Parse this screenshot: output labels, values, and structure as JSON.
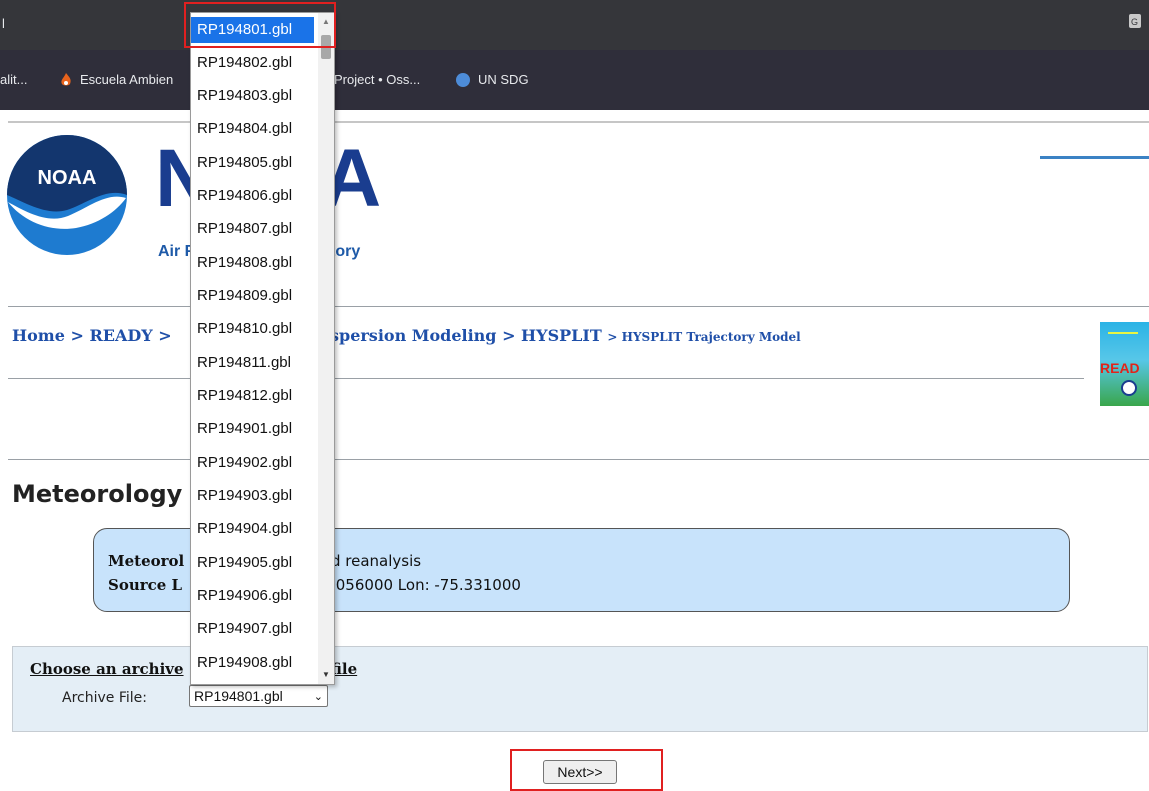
{
  "browser": {
    "tab_title": "l",
    "bookmarks": [
      {
        "label": "alit..."
      },
      {
        "label": "Escuela Ambien"
      },
      {
        "label": "Project • Oss..."
      },
      {
        "label": "UN SDG"
      }
    ]
  },
  "header": {
    "logo_text": "NOAA",
    "title_left": "N",
    "title_right": "A",
    "subtitle_left": "Air F",
    "subtitle_right": "tory"
  },
  "breadcrumb": {
    "home": "Home",
    "ready": "> READY",
    "sep": ">",
    "dispersion": "spersion Modeling",
    "hysplit": "> HYSPLIT",
    "current": "> HYSPLIT Trajectory Model"
  },
  "ready_logo_text": "READ",
  "page_heading": "Meteorology",
  "info": {
    "line1_label": "Meteorol",
    "line1_value": "d reanalysis",
    "line2_label": "Source L",
    "line2_value": ".056000 Lon: -75.331000"
  },
  "archive": {
    "choose_label": "Choose an archive",
    "choose_label_tail": "file",
    "archive_file_label": "Archive File:",
    "selected_value": "RP194801.gbl",
    "options": [
      "RP194801.gbl",
      "RP194802.gbl",
      "RP194803.gbl",
      "RP194804.gbl",
      "RP194805.gbl",
      "RP194806.gbl",
      "RP194807.gbl",
      "RP194808.gbl",
      "RP194809.gbl",
      "RP194810.gbl",
      "RP194811.gbl",
      "RP194812.gbl",
      "RP194901.gbl",
      "RP194902.gbl",
      "RP194903.gbl",
      "RP194904.gbl",
      "RP194905.gbl",
      "RP194906.gbl",
      "RP194907.gbl",
      "RP194908.gbl"
    ]
  },
  "next_button": "Next>>"
}
